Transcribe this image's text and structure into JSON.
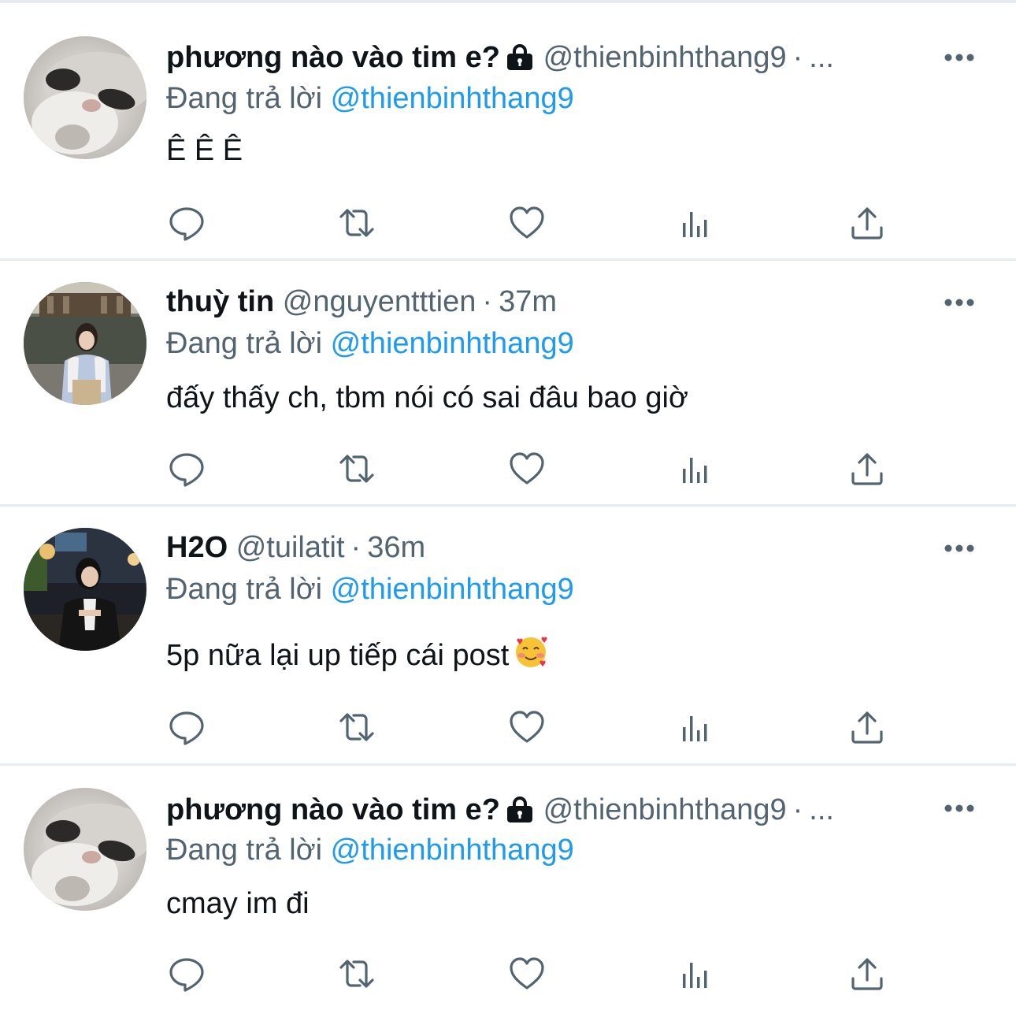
{
  "tweets": [
    {
      "name": "phương nào vào tim e?",
      "handle": "@thienbinhthang9",
      "separator": "·",
      "time": "...",
      "reply_prefix": "Đang trả lời",
      "reply_to": "@thienbinhthang9",
      "text": "Ê Ê Ê",
      "has_lock": true,
      "avatar": "cat-avatar"
    },
    {
      "name": "thuỳ tin",
      "handle": "@nguyentttien",
      "separator": "·",
      "time": "37m",
      "reply_prefix": "Đang trả lời",
      "reply_to": "@thienbinhthang9",
      "text": "đấy thấy ch, tbm nói có sai đâu bao giờ",
      "has_lock": false,
      "avatar": "girl-temple-avatar"
    },
    {
      "name": "H2O",
      "handle": "@tuilatit",
      "separator": "·",
      "time": "36m",
      "reply_prefix": "Đang trả lời",
      "reply_to": "@thienbinhthang9",
      "text": "5p nữa lại up tiếp cái post",
      "emoji": "smiling-face-with-hearts-emoji",
      "has_lock": false,
      "avatar": "girl-night-avatar"
    },
    {
      "name": "phương nào vào tim e?",
      "handle": "@thienbinhthang9",
      "separator": "·",
      "time": "...",
      "reply_prefix": "Đang trả lời",
      "reply_to": "@thienbinhthang9",
      "text": "cmay im đi",
      "has_lock": true,
      "avatar": "cat-avatar"
    }
  ],
  "icons": {
    "reply": "reply-icon",
    "retweet": "retweet-icon",
    "like": "like-icon",
    "views": "views-icon",
    "share": "share-icon",
    "more": "more-icon",
    "lock": "lock-icon"
  },
  "colors": {
    "text": "#0f1419",
    "secondary": "#536471",
    "accent": "#1d9bf0",
    "divider": "#e6ecf0"
  }
}
